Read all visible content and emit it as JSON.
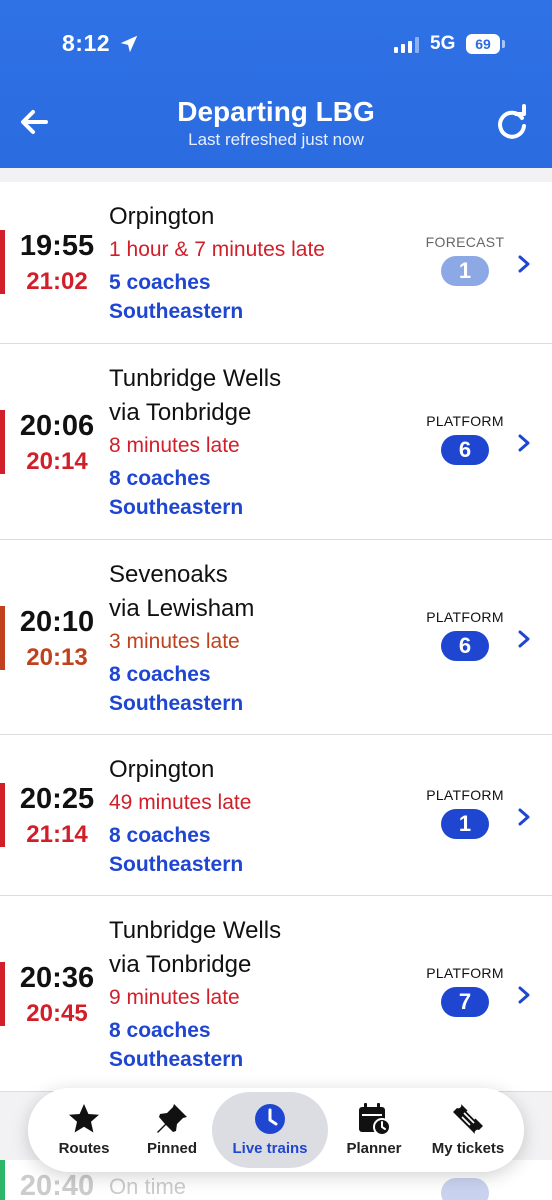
{
  "status": {
    "time": "8:12",
    "network": "5G",
    "battery": "69"
  },
  "header": {
    "title": "Departing LBG",
    "subtitle": "Last refreshed just now"
  },
  "departures": [
    {
      "scheduled": "19:55",
      "expected": "21:02",
      "destination": "Orpington",
      "via": "",
      "status": "1 hour & 7 minutes late",
      "coaches": "5 coaches",
      "operator": "Southeastern",
      "platform_label": "FORECAST",
      "platform": "1"
    },
    {
      "scheduled": "20:06",
      "expected": "20:14",
      "destination": "Tunbridge Wells",
      "via": "via Tonbridge",
      "status": "8 minutes late",
      "coaches": "8 coaches",
      "operator": "Southeastern",
      "platform_label": "PLATFORM",
      "platform": "6"
    },
    {
      "scheduled": "20:10",
      "expected": "20:13",
      "destination": "Sevenoaks",
      "via": "via Lewisham",
      "status": "3 minutes late",
      "coaches": "8 coaches",
      "operator": "Southeastern",
      "platform_label": "PLATFORM",
      "platform": "6"
    },
    {
      "scheduled": "20:25",
      "expected": "21:14",
      "destination": "Orpington",
      "via": "",
      "status": "49 minutes late",
      "coaches": "8 coaches",
      "operator": "Southeastern",
      "platform_label": "PLATFORM",
      "platform": "1"
    },
    {
      "scheduled": "20:36",
      "expected": "20:45",
      "destination": "Tunbridge Wells",
      "via": "via Tonbridge",
      "status": "9 minutes late",
      "coaches": "8 coaches",
      "operator": "Southeastern",
      "platform_label": "PLATFORM",
      "platform": "7"
    }
  ],
  "peek": {
    "scheduled": "20:40",
    "status": "On time"
  },
  "tabs": [
    {
      "label": "Routes",
      "icon": "star-icon"
    },
    {
      "label": "Pinned",
      "icon": "pin-icon"
    },
    {
      "label": "Live trains",
      "icon": "clock-icon"
    },
    {
      "label": "Planner",
      "icon": "calendar-icon"
    },
    {
      "label": "My tickets",
      "icon": "ticket-icon"
    }
  ],
  "colors": {
    "header": "#2b6be0",
    "accent": "#1f46d1",
    "late_red": "#d11f2a",
    "late_orange": "#c0411d",
    "forecast_badge": "#8ca9e6"
  }
}
